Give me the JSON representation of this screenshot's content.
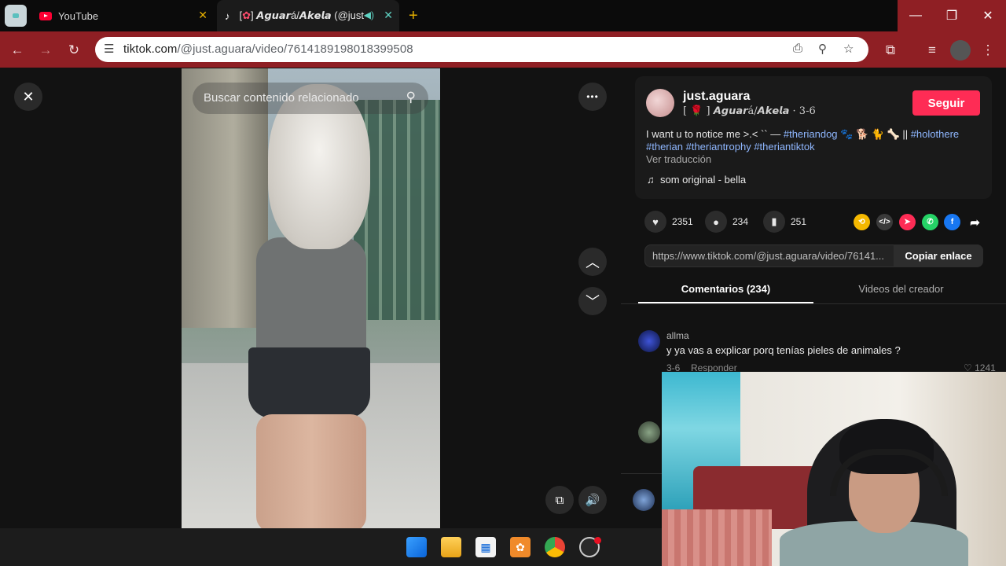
{
  "browser": {
    "tabs": [
      {
        "title": "YouTube"
      },
      {
        "title_prefix": "[",
        "title_icon": "rose-icon",
        "title_main": "] 𝘼𝙜𝙪𝙖𝙧á/𝘼𝙠𝙚𝙡𝙖 (@just"
      }
    ],
    "tab_close": "✕",
    "new_tab": "+",
    "url_host": "tiktok.com",
    "url_path": "/@just.aguara/video/7614189198018399508",
    "window_controls": [
      "minimize",
      "restore",
      "close"
    ]
  },
  "video": {
    "search_placeholder": "Buscar contenido relacionado",
    "more_label": "•••"
  },
  "creator": {
    "username": "just.aguara",
    "nickname": "[ 🌹 ] 𝘼𝙜𝙪𝙖𝙧á/𝘼𝙠𝙚𝙡𝙖 · 3-6",
    "follow_label": "Seguir"
  },
  "description": {
    "text": "I want u to notice me >.< `` — ",
    "tags_line1": "#theriandog",
    "emoji": " 🐾 🐕 🐈 🦴 || ",
    "tag2": "#holothere",
    "tags_line2": "#therian #theriantrophy #theriantiktok",
    "translate": "Ver traducción",
    "music": "som original - bella"
  },
  "stats": {
    "likes": "2351",
    "comments": "234",
    "saves": "251"
  },
  "share": {
    "link": "https://www.tiktok.com/@just.aguara/video/76141...",
    "copy_label": "Copiar enlace",
    "colors": {
      "repost": "#f5b800",
      "embed": "#3a3a3a",
      "tiktok": "#fe2c55",
      "whatsapp": "#25d366",
      "facebook": "#1877f2"
    }
  },
  "tabs": {
    "comments": "Comentarios (234)",
    "creator_videos": "Videos del creador"
  },
  "comments": [
    {
      "user": "allma",
      "text": "y ya vas a explicar porq tenías pieles de animales ?",
      "date": "3-6",
      "reply": "Responder",
      "likes": "1241"
    }
  ],
  "theme": {
    "accent": "#fe2c55",
    "toolbar": "#8f1f24"
  }
}
